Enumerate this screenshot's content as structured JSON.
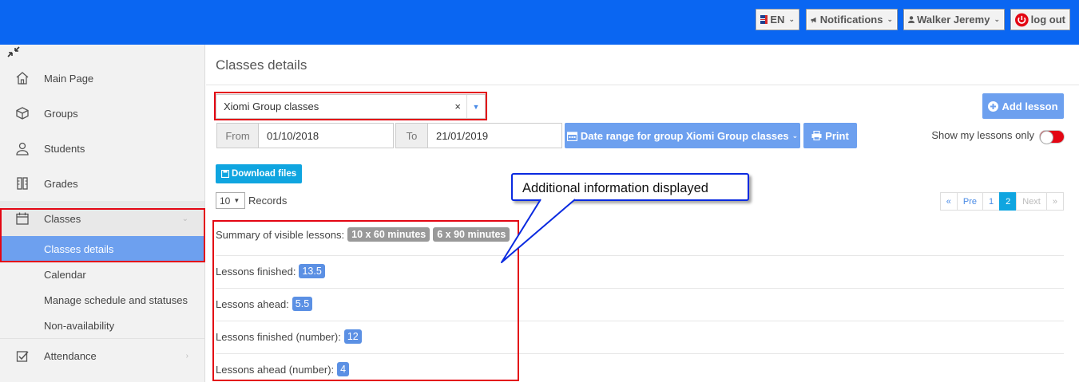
{
  "topbar": {
    "language": "EN",
    "notifications": "Notifications",
    "user": "Walker Jeremy",
    "logout": "log out"
  },
  "sidebar": {
    "items": [
      {
        "label": "Main Page",
        "icon": "home-icon"
      },
      {
        "label": "Groups",
        "icon": "cube-icon"
      },
      {
        "label": "Students",
        "icon": "user-icon"
      },
      {
        "label": "Grades",
        "icon": "ruler-icon"
      },
      {
        "label": "Classes",
        "icon": "calendar-icon"
      },
      {
        "label": "Attendance",
        "icon": "checkbox-icon"
      }
    ],
    "classes_sub": [
      {
        "label": "Classes details"
      },
      {
        "label": "Calendar"
      },
      {
        "label": "Manage schedule and statuses"
      },
      {
        "label": "Non-availability"
      }
    ]
  },
  "main": {
    "title": "Classes details",
    "group_select": {
      "value": "Xiomi Group classes",
      "clear": "×"
    },
    "add_lesson": "Add lesson",
    "date": {
      "from_label": "From",
      "from_value": "01/10/2018",
      "to_label": "To",
      "to_value": "21/01/2019"
    },
    "date_range_button": "Date range for group Xiomi Group classes",
    "print_button": "Print",
    "show_my_lessons": "Show my lessons only",
    "download_files": "Download files",
    "records": {
      "value": "10",
      "label": "Records"
    },
    "pagination": [
      "«",
      "Pre",
      "1",
      "2",
      "Next",
      "»"
    ],
    "summary": {
      "label": "Summary of visible lessons:",
      "badges": [
        "10 x 60 minutes",
        "6 x 90 minutes"
      ]
    },
    "stats": [
      {
        "label": "Lessons finished:",
        "value": "13.5"
      },
      {
        "label": "Lessons ahead:",
        "value": "5.5"
      },
      {
        "label": "Lessons finished (number):",
        "value": "12"
      },
      {
        "label": "Lessons ahead (number):",
        "value": "4"
      }
    ]
  },
  "callout": {
    "text": "Additional information displayed"
  },
  "colors": {
    "topbar": "#0a66f2",
    "accent_blue": "#6da0ef",
    "highlight_red": "#e30613",
    "callout_border": "#0a2ae0"
  }
}
